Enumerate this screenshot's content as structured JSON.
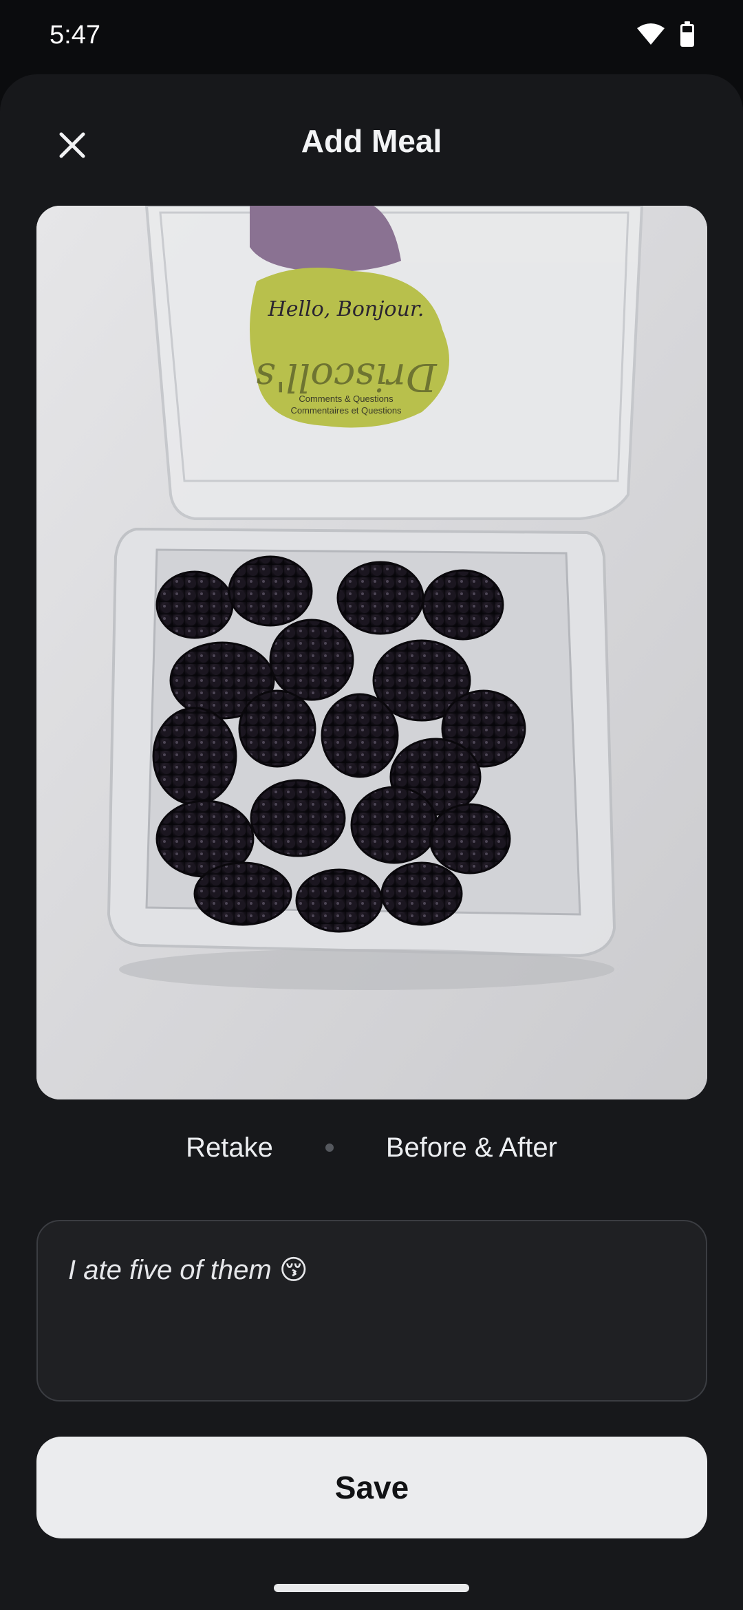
{
  "status_bar": {
    "time": "5:47",
    "icons": [
      "wifi-icon",
      "battery-icon"
    ]
  },
  "header": {
    "title": "Add Meal",
    "close_icon": "close-icon"
  },
  "photo": {
    "subject": "blackberries in plastic clamshell container",
    "label_lines": [
      "Hello, Bonjour.",
      "Driscoll's",
      "Comments & Questions",
      "Commentaires et Questions"
    ]
  },
  "photo_actions": {
    "retake_label": "Retake",
    "before_after_label": "Before & After"
  },
  "note": {
    "value": "I ate five of them 😚"
  },
  "save_label": "Save",
  "colors": {
    "background": "#17181b",
    "save_button": "#ebecee",
    "field_border": "#3b3d42"
  }
}
